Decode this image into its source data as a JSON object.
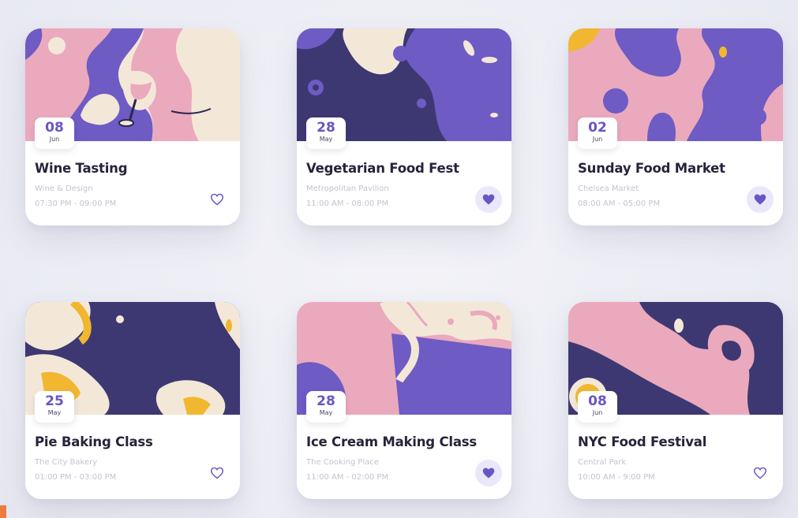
{
  "colors": {
    "accent": "#6a55c4",
    "navy": "#3d3872",
    "purple": "#6e5bc4",
    "pink": "#eba9bd",
    "cream": "#f3e8d8",
    "yellow": "#f2b731",
    "title_text": "#26233a",
    "muted_text": "#c4c2d2"
  },
  "events": [
    {
      "day": "08",
      "month": "Jun",
      "title": "Wine Tasting",
      "venue": "Wine & Design",
      "time": "07:30 PM - 09:00 PM",
      "favorite": false,
      "art": "wine-glass-art"
    },
    {
      "day": "28",
      "month": "May",
      "title": "Vegetarian Food Fest",
      "venue": "Metropolitan Pavilion",
      "time": "11:00 AM - 08:00 PM",
      "favorite": true,
      "art": "abstract-food-art"
    },
    {
      "day": "02",
      "month": "Jun",
      "title": "Sunday Food Market",
      "venue": "Chelsea Market",
      "time": "08:00 AM - 05:00 PM",
      "favorite": true,
      "art": "abstract-blobs-art"
    },
    {
      "day": "25",
      "month": "May",
      "title": "Pie Baking Class",
      "venue": "The City Bakery",
      "time": "01:00 PM - 03:00 PM",
      "favorite": false,
      "art": "pie-art"
    },
    {
      "day": "28",
      "month": "May",
      "title": "Ice Cream Making Class",
      "venue": "The Cooking Place",
      "time": "11:00 AM - 02:00 PM",
      "favorite": true,
      "art": "ice-cream-art"
    },
    {
      "day": "08",
      "month": "Jun",
      "title": "NYC Food Festival",
      "venue": "Central Park",
      "time": "10:00 AM - 9:00 PM",
      "favorite": false,
      "art": "festival-art"
    }
  ],
  "icons": {
    "favorite_on": "heart-filled-icon",
    "favorite_off": "heart-outline-icon"
  }
}
